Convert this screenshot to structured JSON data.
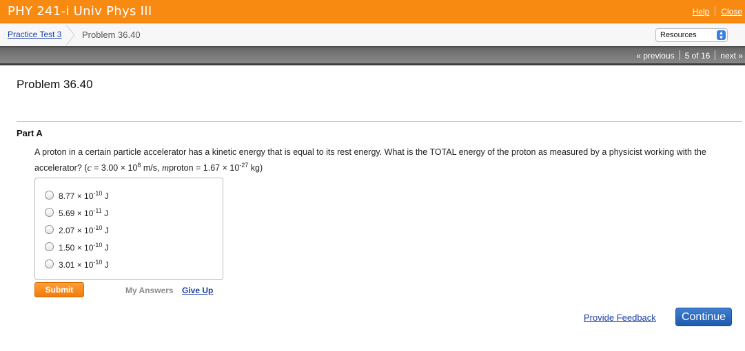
{
  "header": {
    "course_title": "PHY 241-i Univ Phys III",
    "help_label": "Help",
    "close_label": "Close",
    "background_color": "#f88a12"
  },
  "breadcrumb": {
    "parent_label": "Practice Test 3",
    "current_label": "Problem 36.40"
  },
  "resources": {
    "label": "Resources"
  },
  "navigation": {
    "previous_label": "« previous",
    "position_label": "5 of 16",
    "next_label": "next »"
  },
  "problem": {
    "title": "Problem 36.40",
    "part_title": "Part A",
    "question_text": "A proton in a certain particle accelerator has a kinetic energy that is equal to its rest energy. What is the TOTAL energy of the proton as measured by a physicist working with the accelerator?",
    "given": {
      "c_symbol": "c",
      "c_value": " = 3.00 × 10",
      "c_exp": "8",
      "c_unit": " m/s, ",
      "m_symbol": "m",
      "m_sub": "proton",
      "m_value": " = 1.67 × 10",
      "m_exp": "-27",
      "m_unit": " kg"
    },
    "choices": [
      {
        "mantissa": "8.77 × 10",
        "exponent": "-10",
        "unit": " J"
      },
      {
        "mantissa": "5.69 × 10",
        "exponent": "-11",
        "unit": " J"
      },
      {
        "mantissa": "2.07 × 10",
        "exponent": "-10",
        "unit": " J"
      },
      {
        "mantissa": "1.50 × 10",
        "exponent": "-10",
        "unit": " J"
      },
      {
        "mantissa": "3.01 × 10",
        "exponent": "-10",
        "unit": " J"
      }
    ]
  },
  "actions": {
    "submit_label": "Submit",
    "my_answers_label": "My Answers",
    "give_up_label": "Give Up",
    "feedback_label": "Provide Feedback",
    "continue_label": "Continue"
  }
}
